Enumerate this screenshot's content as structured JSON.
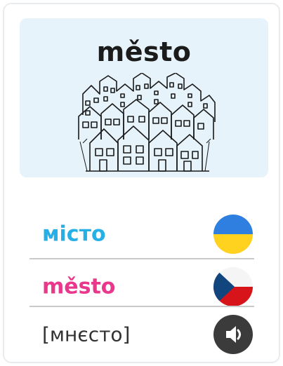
{
  "illustration": {
    "title": "město",
    "subject": "hand-drawn sketch of a city with many houses"
  },
  "rows": [
    {
      "word": "місто",
      "language": "Ukrainian",
      "icon": "ukraine-flag-icon",
      "color": "#27b0e6"
    },
    {
      "word": "město",
      "language": "Czech",
      "icon": "czech-flag-icon",
      "color": "#e9388c"
    },
    {
      "word": "[мнєсто]",
      "language": "transcription",
      "icon": "speaker-icon",
      "color": "#333333"
    }
  ],
  "colors": {
    "panel_bg": "#e7f3fa",
    "divider": "#c9c9c9",
    "ukraine_blue": "#2f7fe0",
    "ukraine_yellow": "#ffd21f",
    "czech_white": "#f5f5f5",
    "czech_red": "#d7141a",
    "czech_blue": "#11457e",
    "speaker_bg": "#3b3b3b"
  }
}
